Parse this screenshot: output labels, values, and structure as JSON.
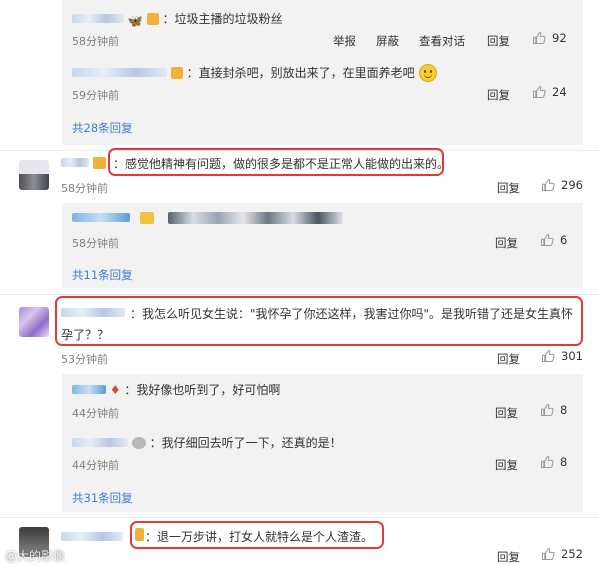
{
  "thread1": {
    "reply1": {
      "text": "：垃圾主播的垃圾粉丝",
      "time": "58分钟前",
      "actions": [
        "举报",
        "屏蔽",
        "查看对话",
        "回复"
      ],
      "likes": "92"
    },
    "reply2": {
      "text": "：直接封杀吧，别放出来了，在里面养老吧",
      "time": "59分钟前",
      "reply": "回复",
      "likes": "24"
    },
    "more": "共28条回复"
  },
  "comment1": {
    "text": "：感觉他精神有问题，做的很多是都不是正常人能做的出来的。",
    "time": "58分钟前",
    "reply": "回复",
    "likes": "296",
    "reply1": {
      "time": "58分钟前",
      "reply": "回复",
      "likes": "6"
    },
    "more": "共11条回复"
  },
  "comment2": {
    "text_line1": "：我怎么听见女生说：\"我怀孕了你还这样，我害过你吗\"。是我听错了还是女生真怀",
    "text_line2": "孕了？？",
    "time": "53分钟前",
    "reply": "回复",
    "likes": "301",
    "reply1": {
      "text": "：我好像也听到了，好可怕啊",
      "time": "44分钟前",
      "reply": "回复",
      "likes": "8"
    },
    "reply2": {
      "text": "：我仔细回去听了一下，还真的是！",
      "time": "44分钟前",
      "reply": "回复",
      "likes": "8"
    },
    "more": "共31条回复"
  },
  "comment3": {
    "text": "：退一万步讲，打女人就特么是个人渣渣。",
    "reply": "回复",
    "likes": "252"
  },
  "watermark": "@大的影像",
  "colors": {
    "highlight": "#e03b3b",
    "link": "#3e7bd6",
    "reply_bg": "#f2f2f2"
  }
}
